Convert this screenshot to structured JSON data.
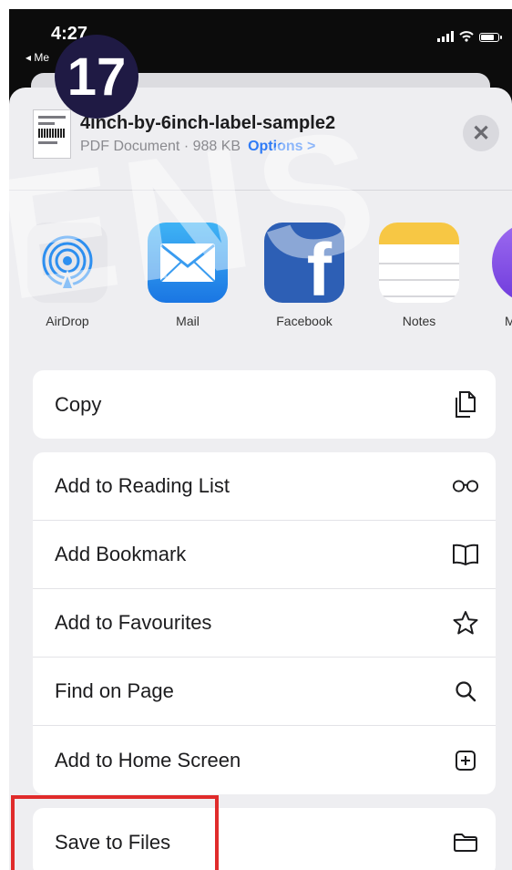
{
  "status_bar": {
    "time": "4:27",
    "back_label": "◂ Me"
  },
  "step_badge": "17",
  "watermark": "ENS",
  "share_sheet": {
    "file_name": "4inch-by-6inch-label-sample2",
    "file_meta": "PDF Document · 988 KB",
    "options_label": "Options >",
    "close_label": "✕"
  },
  "apps": [
    {
      "label": "AirDrop",
      "icon": "airdrop-icon"
    },
    {
      "label": "Mail",
      "icon": "mail-icon"
    },
    {
      "label": "Facebook",
      "icon": "facebook-icon"
    },
    {
      "label": "Notes",
      "icon": "notes-icon"
    },
    {
      "label": "M",
      "icon": "more-app-icon"
    }
  ],
  "actions_group1": [
    {
      "label": "Copy",
      "icon": "copy-icon"
    }
  ],
  "actions_group2": [
    {
      "label": "Add to Reading List",
      "icon": "glasses-icon"
    },
    {
      "label": "Add Bookmark",
      "icon": "book-icon"
    },
    {
      "label": "Add to Favourites",
      "icon": "star-icon"
    },
    {
      "label": "Find on Page",
      "icon": "search-icon"
    },
    {
      "label": "Add to Home Screen",
      "icon": "plus-square-icon"
    }
  ],
  "actions_group3": [
    {
      "label": "Save to Files",
      "icon": "folder-icon"
    }
  ],
  "colors": {
    "accent": "#2f7bf6",
    "highlight": "#e02b2b"
  }
}
